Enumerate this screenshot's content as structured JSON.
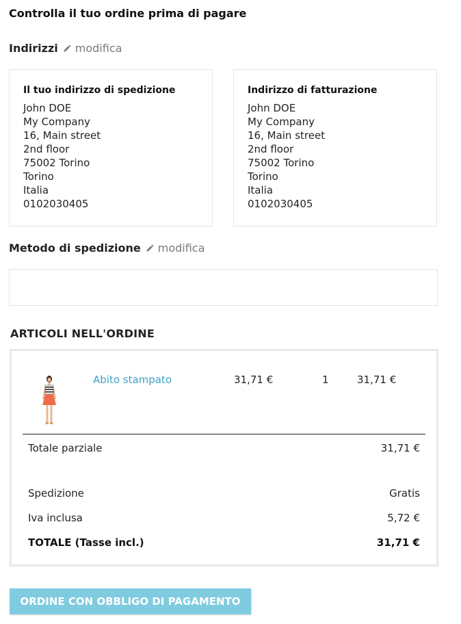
{
  "page_title": "Controlla il tuo ordine prima di pagare",
  "addresses": {
    "heading": "Indirizzi",
    "edit_label": "modifica",
    "delivery": {
      "title": "Il tuo indirizzo di spedizione",
      "lines": [
        "John DOE",
        "My Company",
        "16, Main street",
        "2nd floor",
        "75002 Torino",
        "Torino",
        "Italia",
        "0102030405"
      ]
    },
    "invoice": {
      "title": "Indirizzo di fatturazione",
      "lines": [
        "John DOE",
        "My Company",
        "16, Main street",
        "2nd floor",
        "75002 Torino",
        "Torino",
        "Italia",
        "0102030405"
      ]
    }
  },
  "shipping_method": {
    "heading": "Metodo di spedizione",
    "edit_label": "modifica"
  },
  "order_items": {
    "heading": "ARTICOLI NELL'ORDINE",
    "products": [
      {
        "name": "Abito stampato",
        "unit_price": "31,71 €",
        "quantity": "1",
        "total": "31,71 €"
      }
    ],
    "subtotal_label": "Totale parziale",
    "subtotal_value": "31,71 €",
    "shipping_label": "Spedizione",
    "shipping_value": "Gratis",
    "tax_label": "Iva inclusa",
    "tax_value": "5,72 €",
    "total_label": "TOTALE (Tasse incl.)",
    "total_value": "31,71 €"
  },
  "confirm_button": "ORDINE CON OBBLIGO DI PAGAMENTO",
  "colors": {
    "link": "#3fa3c4",
    "button_bg": "#7fcbe0",
    "muted": "#7a7a7a"
  }
}
